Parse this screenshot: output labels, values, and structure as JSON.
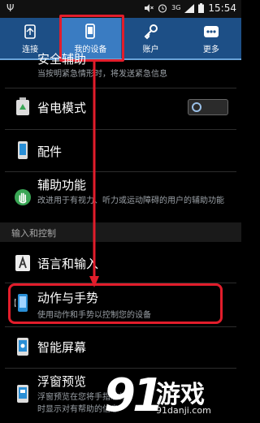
{
  "status_bar": {
    "time": "15:54",
    "network": "3G"
  },
  "tabs": [
    {
      "label": "连接",
      "icon": "connections-icon"
    },
    {
      "label": "我的设备",
      "icon": "my-device-icon",
      "selected": true
    },
    {
      "label": "账户",
      "icon": "accounts-icon"
    },
    {
      "label": "更多",
      "icon": "more-icon"
    }
  ],
  "list": {
    "partial_item": {
      "title": "安全辅助",
      "subtitle": "当按明紧急情形时，将发送紧急信息"
    },
    "power_saving": {
      "title": "省电模式",
      "toggle_on": false
    },
    "accessories": {
      "title": "配件"
    },
    "accessibility": {
      "title": "辅助功能",
      "subtitle": "改进用于有视力、听力或运动障碍的用户的辅助功能"
    },
    "section_header": "输入和控制",
    "language_input": {
      "title": "语言和输入"
    },
    "motions_gestures": {
      "title": "动作与手势",
      "subtitle": "使用动作和手势以控制您的设备"
    },
    "smart_screen": {
      "title": "智能屏幕"
    },
    "popup_view": {
      "title": "浮窗预览",
      "subtitle": "浮窗预览在您将手指悬停时显示对有帮助的信息"
    }
  },
  "watermark": {
    "logo_text": "91",
    "name": "游戏",
    "url": "91danji.com"
  },
  "colors": {
    "accent_blue": "#1d4f86",
    "selected_tab": "#3a7cc2",
    "annotation_red": "#e21d2b"
  }
}
